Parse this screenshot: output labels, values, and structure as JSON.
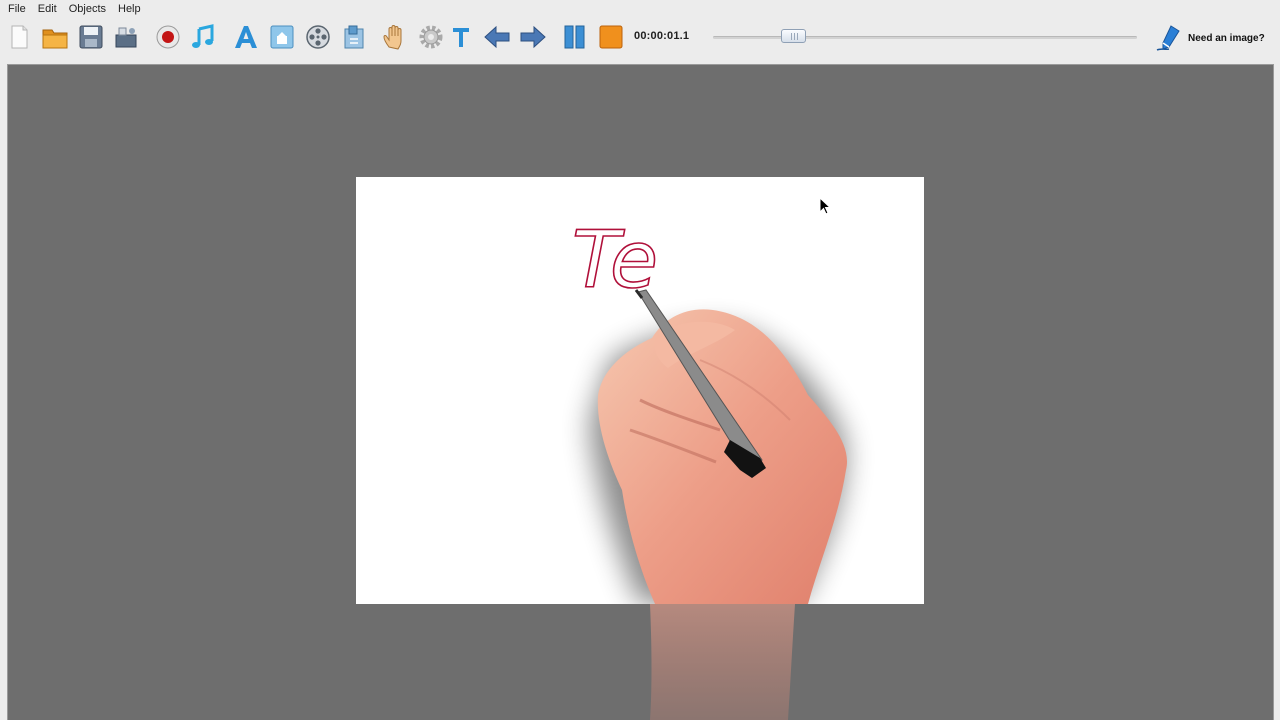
{
  "menu": [
    "File",
    "Edit",
    "Objects",
    "Help"
  ],
  "toolbar": {
    "buttons": [
      {
        "name": "new-icon"
      },
      {
        "name": "open-folder-icon"
      },
      {
        "name": "save-icon"
      },
      {
        "name": "export-icon"
      },
      {
        "name": "record-icon"
      },
      {
        "name": "music-icon"
      },
      {
        "name": "text-a-icon"
      },
      {
        "name": "image-icon"
      },
      {
        "name": "film-reel-icon"
      },
      {
        "name": "import-icon"
      },
      {
        "name": "hand-icon"
      },
      {
        "name": "gear-icon"
      },
      {
        "name": "text-t-icon"
      },
      {
        "name": "arrow-left-icon"
      },
      {
        "name": "arrow-right-icon"
      },
      {
        "name": "pause-icon"
      },
      {
        "name": "stop-icon"
      }
    ],
    "time": "00:00:01.1",
    "slider_value": 0.17,
    "need_image": "Need an image?"
  },
  "canvas": {
    "written_text": "Te",
    "text_color": "#b0103a"
  }
}
